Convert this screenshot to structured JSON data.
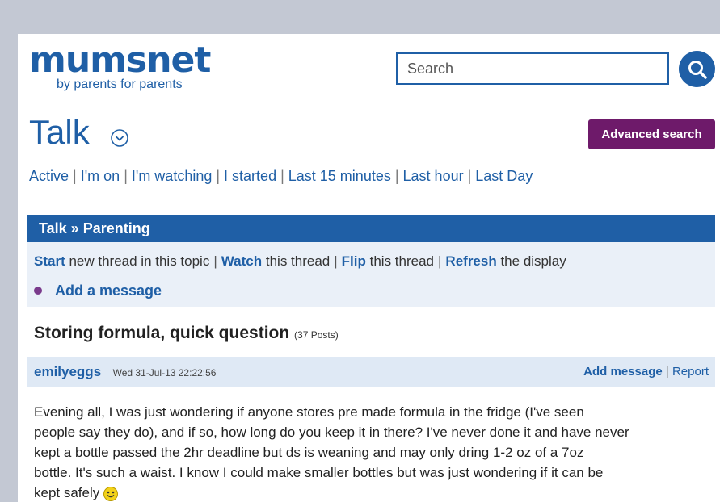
{
  "header": {
    "logo_text": "mumsnet",
    "tagline": "by parents for parents",
    "search_placeholder": "Search"
  },
  "section": {
    "title": "Talk",
    "advanced_search_label": "Advanced search"
  },
  "filters": [
    "Active",
    "I'm on",
    "I'm watching",
    "I started",
    "Last 15 minutes",
    "Last hour",
    "Last Day"
  ],
  "breadcrumb": "Talk » Parenting",
  "thread_actions": {
    "start_label": "Start",
    "start_suffix": " new thread in this topic",
    "watch_label": "Watch",
    "watch_suffix": " this thread",
    "flip_label": "Flip",
    "flip_suffix": " this thread",
    "refresh_label": "Refresh",
    "refresh_suffix": " the display"
  },
  "add_message_label": "Add a message",
  "thread": {
    "title": "Storing formula, quick question",
    "post_count": "(37 Posts)"
  },
  "post": {
    "author": "emilyeggs",
    "date": "Wed 31-Jul-13 22:22:56",
    "add_message_label": "Add message",
    "report_label": "Report",
    "body_lines": [
      "Evening all, I was just wondering if anyone stores pre made formula in the fridge (I've seen",
      "people say they do), and if so, how long do you keep it in there? I've never done it and have never",
      "kept a bottle passed the 2hr deadline but ds is weaning and may only dring 1-2 oz of a 7oz",
      "bottle. It's such a waist. I know I could make smaller bottles but was just wondering if it can be",
      "kept safely"
    ]
  },
  "colors": {
    "brand_blue": "#1f5fa6",
    "advanced_button": "#6e1a6a",
    "light_panel": "#eaf0f8",
    "post_header": "#dfe9f5"
  },
  "icons": {
    "search": "search-icon",
    "chevron": "chevron-down-circle-icon",
    "bullet": "bullet-dot-icon",
    "smiley": "smiley-icon"
  }
}
